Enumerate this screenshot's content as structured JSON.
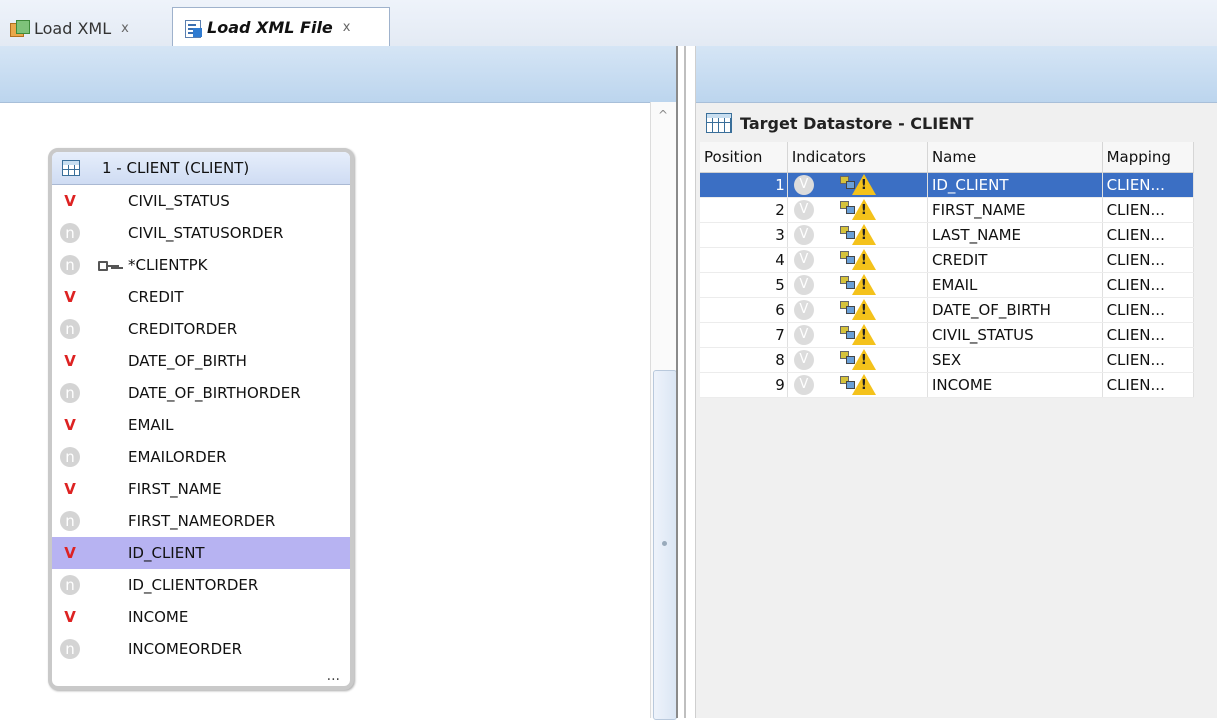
{
  "tabs": [
    {
      "label": "Load XML",
      "close": "x"
    },
    {
      "label": "Load XML File",
      "close": "x"
    }
  ],
  "entity": {
    "title": "1 - CLIENT (CLIENT)",
    "attributes": [
      {
        "badge": "V",
        "name": "CIVIL_STATUS"
      },
      {
        "badge": "n",
        "name": "CIVIL_STATUSORDER"
      },
      {
        "badge": "n",
        "name": "*CLIENTPK",
        "key": true
      },
      {
        "badge": "V",
        "name": "CREDIT"
      },
      {
        "badge": "n",
        "name": "CREDITORDER"
      },
      {
        "badge": "V",
        "name": "DATE_OF_BIRTH"
      },
      {
        "badge": "n",
        "name": "DATE_OF_BIRTHORDER"
      },
      {
        "badge": "V",
        "name": "EMAIL"
      },
      {
        "badge": "n",
        "name": "EMAILORDER"
      },
      {
        "badge": "V",
        "name": "FIRST_NAME"
      },
      {
        "badge": "n",
        "name": "FIRST_NAMEORDER"
      },
      {
        "badge": "V",
        "name": "ID_CLIENT",
        "selected": true
      },
      {
        "badge": "n",
        "name": "ID_CLIENTORDER"
      },
      {
        "badge": "V",
        "name": "INCOME"
      },
      {
        "badge": "n",
        "name": "INCOMEORDER"
      }
    ],
    "more": "..."
  },
  "datastore": {
    "title": "Target Datastore - CLIENT",
    "columns": [
      "Position",
      "Indicators",
      "Name",
      "Mapping"
    ],
    "indicator_v": "V",
    "rows": [
      {
        "position": "1",
        "name": "ID_CLIENT",
        "mapping": "CLIEN...",
        "selected": true
      },
      {
        "position": "2",
        "name": "FIRST_NAME",
        "mapping": "CLIEN..."
      },
      {
        "position": "3",
        "name": "LAST_NAME",
        "mapping": "CLIEN..."
      },
      {
        "position": "4",
        "name": "CREDIT",
        "mapping": "CLIEN..."
      },
      {
        "position": "5",
        "name": "EMAIL",
        "mapping": "CLIEN..."
      },
      {
        "position": "6",
        "name": "DATE_OF_BIRTH",
        "mapping": "CLIEN..."
      },
      {
        "position": "7",
        "name": "CIVIL_STATUS",
        "mapping": "CLIEN..."
      },
      {
        "position": "8",
        "name": "SEX",
        "mapping": "CLIEN..."
      },
      {
        "position": "9",
        "name": "INCOME",
        "mapping": "CLIEN..."
      }
    ]
  },
  "colors": {
    "selection": "#3b6fc4",
    "attr_selection": "#b7b3f2",
    "v_badge": "#d22",
    "warning": "#f4c21b"
  }
}
